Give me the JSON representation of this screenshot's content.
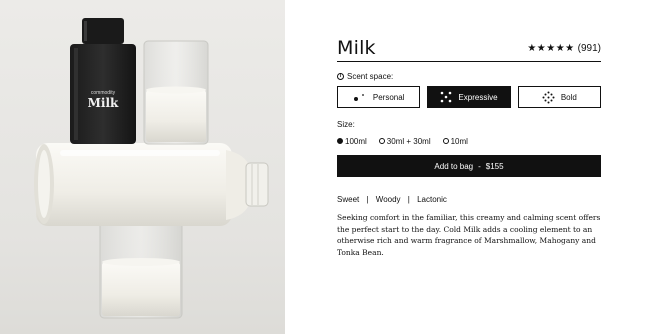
{
  "hero": {
    "bottle_brand": "commodity",
    "bottle_name": "Milk"
  },
  "product": {
    "title": "Milk",
    "stars": "★★★★★",
    "review_count": "(991)"
  },
  "scent": {
    "label": "Scent space:",
    "info_icon": "ⓘ",
    "options": [
      {
        "label": "Personal",
        "icon": "personal-icon",
        "selected": false
      },
      {
        "label": "Expressive",
        "icon": "expressive-icon",
        "selected": true
      },
      {
        "label": "Bold",
        "icon": "bold-icon",
        "selected": false
      }
    ]
  },
  "size": {
    "label": "Size:",
    "options": [
      {
        "label": "100ml",
        "selected": true
      },
      {
        "label": "30ml + 30ml",
        "selected": false
      },
      {
        "label": "10ml",
        "selected": false
      }
    ]
  },
  "cart": {
    "label": "Add to bag",
    "separator": "-",
    "price": "$155"
  },
  "notes": {
    "items": [
      "Sweet",
      "Woody",
      "Lactonic"
    ],
    "separator": "|"
  },
  "description": "Seeking comfort in the familiar, this creamy and calming scent offers the perfect start to the day. Cold Milk adds a cooling element to an otherwise rich and warm fragrance of Marshmallow, Mahogany and Tonka Bean.",
  "colors": {
    "accent": "#111111",
    "background": "#ffffff",
    "hero_bg": "#e8e7e4"
  }
}
